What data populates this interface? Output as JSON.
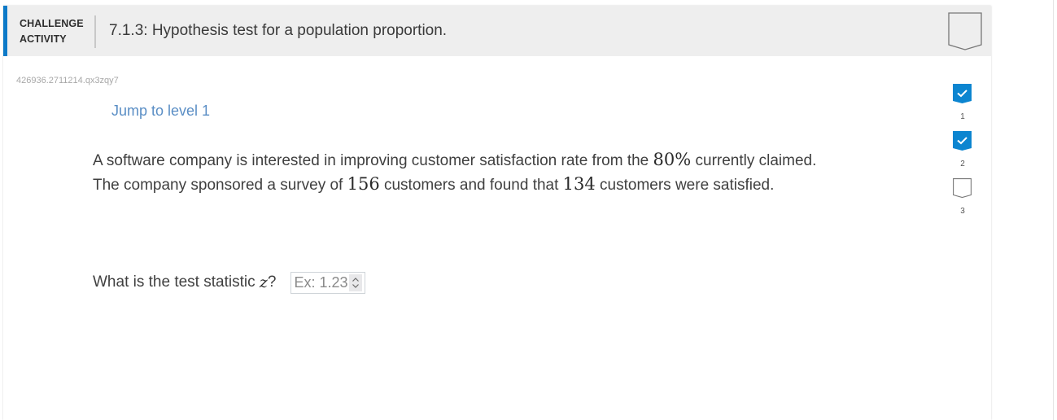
{
  "header": {
    "activity_type_line1": "CHALLENGE",
    "activity_type_line2": "ACTIVITY",
    "title": "7.1.3: Hypothesis test for a population proportion.",
    "accent_color": "#0c7ac8"
  },
  "activity_id": "426936.2711214.qx3zqy7",
  "jump_link": "Jump to level 1",
  "problem": {
    "line1_before": "A software company is interested in improving customer satisfaction rate from the ",
    "claimed_rate": "80%",
    "line1_after": " currently claimed.",
    "line2_before": "The company sponsored a survey of ",
    "sample_size": "156",
    "line2_middle": " customers and found that ",
    "satisfied_count": "134",
    "line2_after": " customers were satisfied."
  },
  "question": {
    "text_before": "What is the test statistic ",
    "variable": "z",
    "text_after": "?",
    "input_value": "",
    "input_placeholder": "Ex: 1.23"
  },
  "levels": [
    {
      "number": "1",
      "status": "completed"
    },
    {
      "number": "2",
      "status": "completed"
    },
    {
      "number": "3",
      "status": "incomplete"
    }
  ],
  "colors": {
    "completed": "#0c85d0",
    "link": "#5a8ec5"
  }
}
